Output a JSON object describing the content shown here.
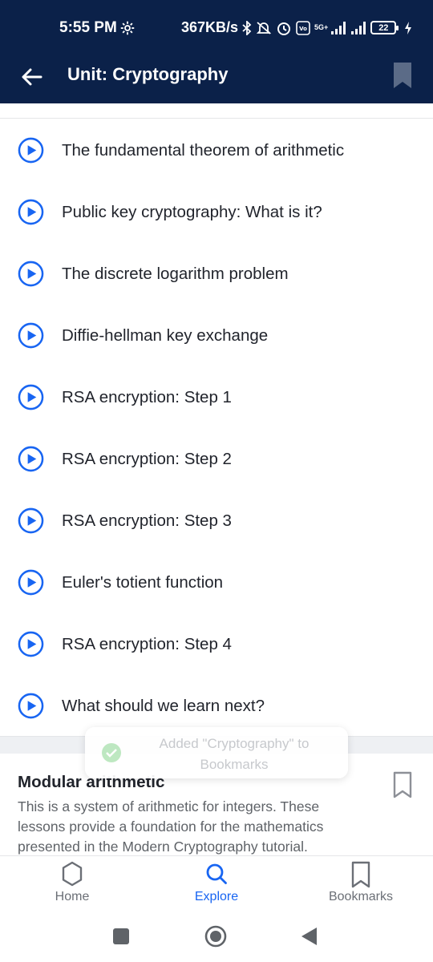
{
  "status_bar": {
    "time": "5:55 PM",
    "network_speed": "367KB/s",
    "battery": "22",
    "network_type": "5G+"
  },
  "app_bar": {
    "title": "Unit: Cryptography",
    "back_icon": "arrow-left-icon",
    "bookmark_icon": "bookmark-filled-icon"
  },
  "lessons": [
    {
      "label": "The fundamental theorem of arithmetic",
      "icon": "play-circle-icon"
    },
    {
      "label": "Public key cryptography: What is it?",
      "icon": "play-circle-icon"
    },
    {
      "label": "The discrete logarithm problem",
      "icon": "play-circle-icon"
    },
    {
      "label": "Diffie-hellman key exchange",
      "icon": "play-circle-icon"
    },
    {
      "label": "RSA encryption: Step 1",
      "icon": "play-circle-icon"
    },
    {
      "label": "RSA encryption: Step 2",
      "icon": "play-circle-icon"
    },
    {
      "label": "RSA encryption: Step 3",
      "icon": "play-circle-icon"
    },
    {
      "label": "Euler's totient function",
      "icon": "play-circle-icon"
    },
    {
      "label": "RSA encryption: Step 4",
      "icon": "play-circle-icon"
    },
    {
      "label": "What should we learn next?",
      "icon": "play-circle-icon"
    }
  ],
  "next_unit": {
    "title": "Modular arithmetic",
    "description": "This is a system of arithmetic for integers. These lessons provide a foundation for the mathematics presented in the Modern Cryptography tutorial."
  },
  "toast": {
    "message": "Added \"Cryptography\" to Bookmarks"
  },
  "bottom_nav": {
    "items": [
      {
        "label": "Home",
        "icon": "hexagon-icon",
        "active": false
      },
      {
        "label": "Explore",
        "icon": "search-icon",
        "active": true
      },
      {
        "label": "Bookmarks",
        "icon": "bookmark-outline-icon",
        "active": false
      }
    ]
  },
  "colors": {
    "header_bg": "#0b2149",
    "accent": "#1865f2",
    "text": "#21242c",
    "muted": "#6b6f76"
  }
}
